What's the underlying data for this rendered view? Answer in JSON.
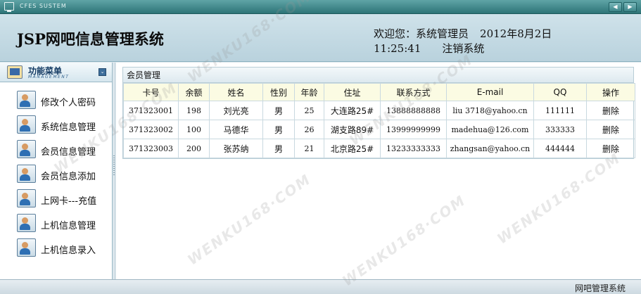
{
  "window": {
    "system_label": "CFES SUSTEM",
    "nav_prev": "◀",
    "nav_next": "▶"
  },
  "header": {
    "title": "JSP网吧信息管理系统",
    "welcome": "欢迎您：",
    "user_role": "系统管理员",
    "date": "2012年8月2日",
    "time": "11:25:41",
    "logout_label": "注销系统"
  },
  "sidebar": {
    "title": "功能菜单",
    "subtitle": "MANAGEMENT",
    "collapse_glyph": "⌄",
    "items": [
      {
        "label": "修改个人密码",
        "icon": "user-icon"
      },
      {
        "label": "系统信息管理",
        "icon": "user-icon"
      },
      {
        "label": "会员信息管理",
        "icon": "user-icon"
      },
      {
        "label": "会员信息添加",
        "icon": "user-icon"
      },
      {
        "label": "上网卡---充值",
        "icon": "user-icon"
      },
      {
        "label": "上机信息管理",
        "icon": "user-icon"
      },
      {
        "label": "上机信息录入",
        "icon": "user-icon"
      }
    ]
  },
  "panel": {
    "title": "会员管理",
    "columns": [
      "卡号",
      "余额",
      "姓名",
      "性别",
      "年龄",
      "住址",
      "联系方式",
      "E-mail",
      "QQ",
      "操作"
    ],
    "rows": [
      [
        "371323001",
        "198",
        "刘光亮",
        "男",
        "25",
        "大连路25#",
        "13888888888",
        "liu 3718@yahoo.cn",
        "111111",
        "删除"
      ],
      [
        "371323002",
        "100",
        "马德华",
        "男",
        "26",
        "湖支路89#",
        "13999999999",
        "madehua@126.com",
        "333333",
        "删除"
      ],
      [
        "371323003",
        "200",
        "张苏纳",
        "男",
        "21",
        "北京路25#",
        "13233333333",
        "zhangsan@yahoo.cn",
        "444444",
        "删除"
      ]
    ]
  },
  "statusbar": {
    "text": "网吧管理系统"
  },
  "watermark": {
    "text": "WENKU168·COM"
  }
}
